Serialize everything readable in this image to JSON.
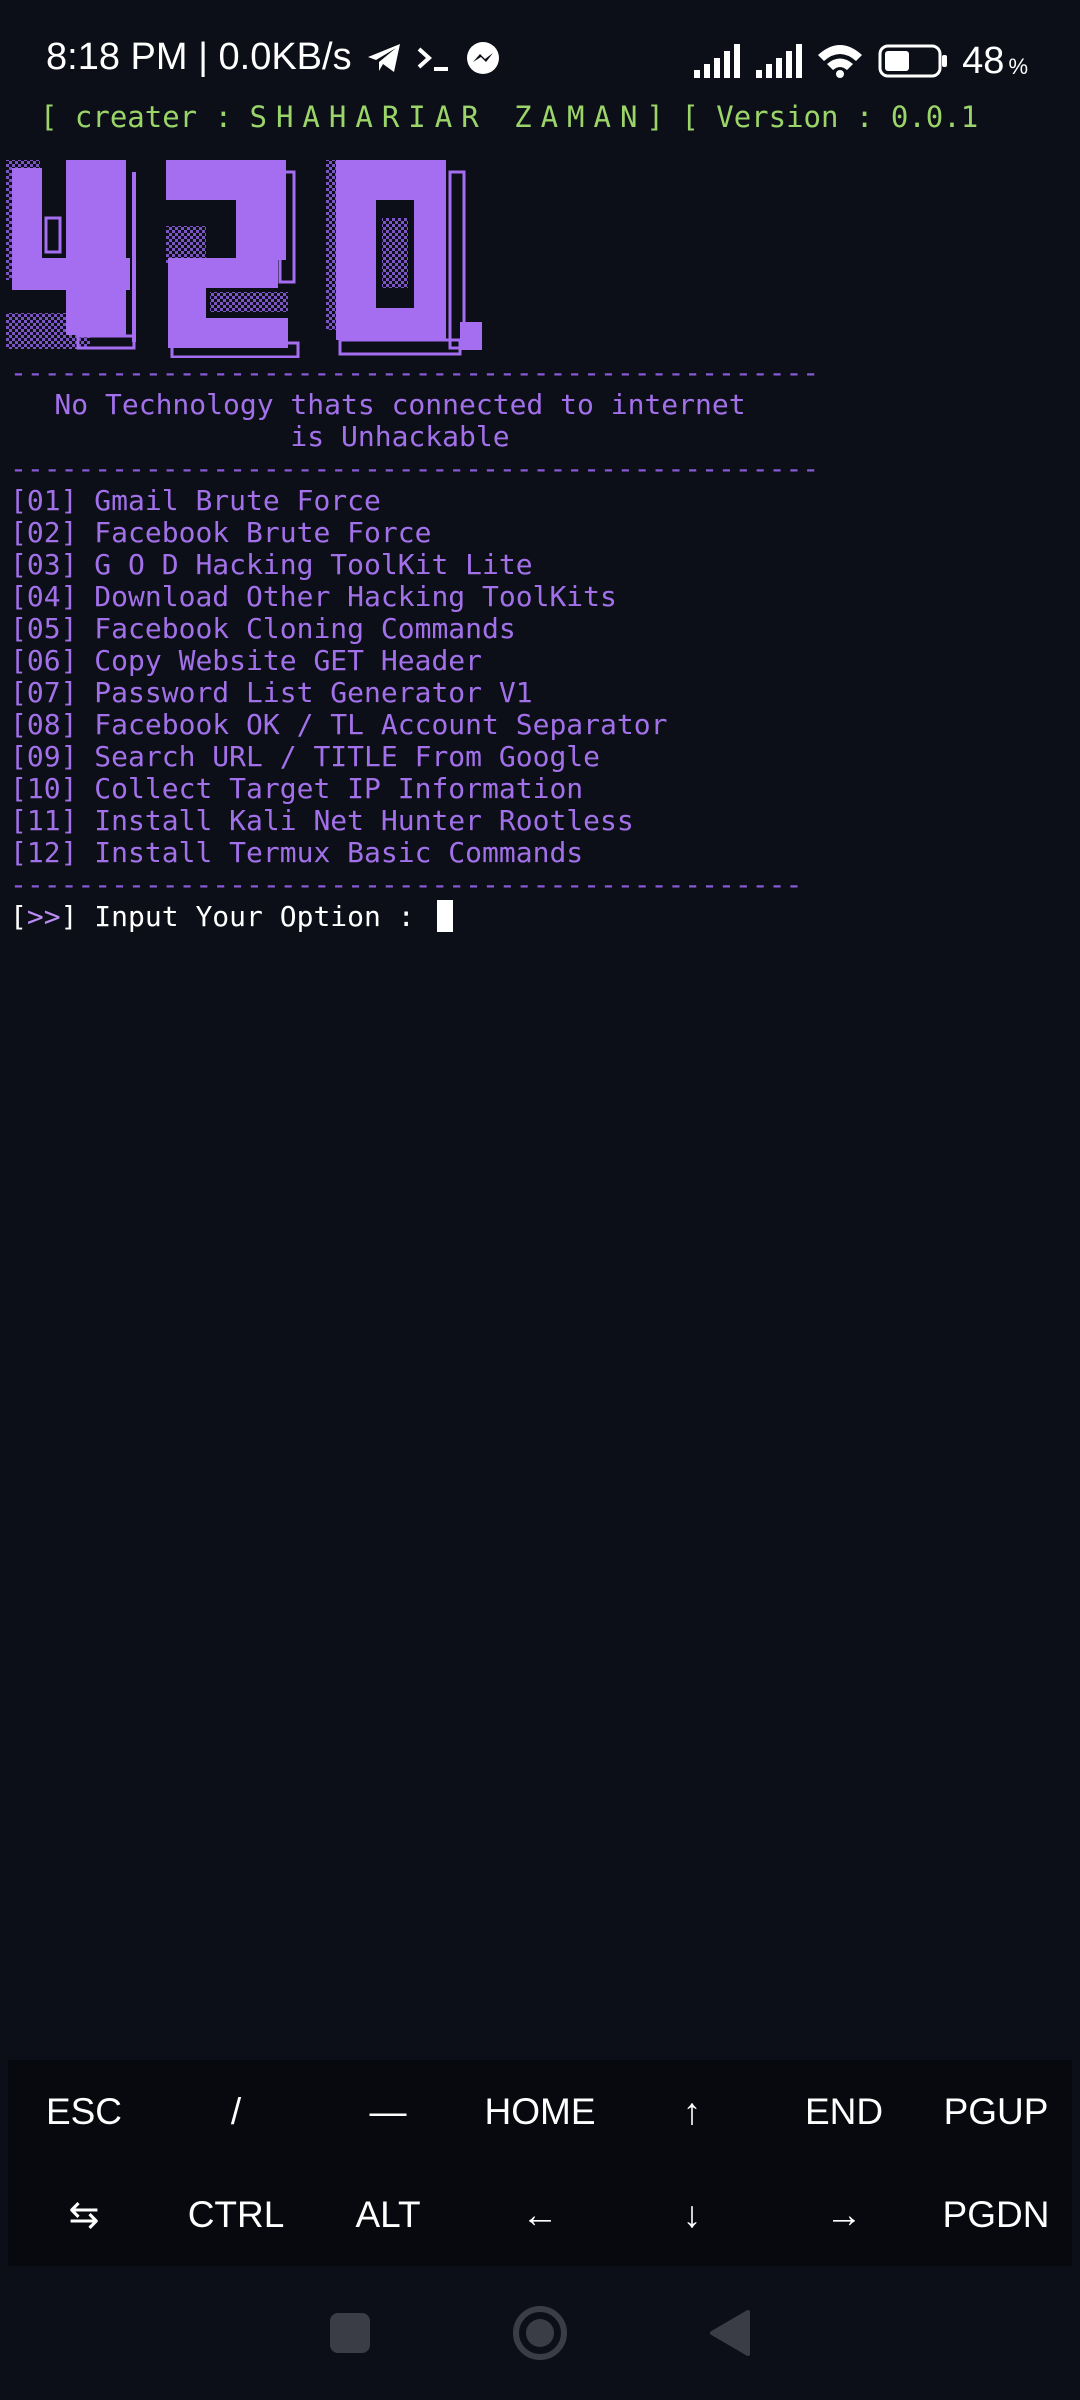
{
  "status": {
    "time_net": "8:18 PM | 0.0KB/s",
    "battery_pct": "48",
    "pct_sign": "%",
    "battery_level": 0.48
  },
  "creator_line": {
    "prefix": "[ creater : ",
    "name": "SHAHARIAR ZAMAN",
    "mid": "] [ Version : ",
    "version": "0.0.1"
  },
  "banner": {
    "logo_text": "420",
    "divider": "------------------------------------------------",
    "tagline_1": "No Technology thats connected to internet",
    "tagline_2": "is Unhackable",
    "divider_2": "-----------------------------------------------"
  },
  "menu": [
    {
      "num": "[01]",
      "label": "Gmail Brute Force"
    },
    {
      "num": "[02]",
      "label": "Facebook Brute Force"
    },
    {
      "num": "[03]",
      "label": "G O D Hacking ToolKit Lite"
    },
    {
      "num": "[04]",
      "label": "Download Other Hacking ToolKits"
    },
    {
      "num": "[05]",
      "label": "Facebook Cloning Commands"
    },
    {
      "num": "[06]",
      "label": "Copy Website GET Header"
    },
    {
      "num": "[07]",
      "label": "Password List Generator V1"
    },
    {
      "num": "[08]",
      "label": "Facebook OK / TL Account Separator"
    },
    {
      "num": "[09]",
      "label": "Search URL / TITLE From Google"
    },
    {
      "num": "[10]",
      "label": "Collect Target IP Information"
    },
    {
      "num": "[11]",
      "label": "Install Kali Net Hunter Rootless"
    },
    {
      "num": "[12]",
      "label": "Install Termux Basic Commands"
    }
  ],
  "prompt": {
    "open": "[",
    "arrows": ">>",
    "close": "]",
    "text": " Input Your Option : "
  },
  "extra_keys": {
    "row1": [
      "ESC",
      "/",
      "—",
      "HOME",
      "↑",
      "END",
      "PGUP"
    ],
    "row2": [
      "⇆",
      "CTRL",
      "ALT",
      "←",
      "↓",
      "→",
      "PGDN"
    ]
  },
  "colors": {
    "background": "#0c0f17",
    "purple": "#a271ea",
    "green": "#9bd56a"
  }
}
